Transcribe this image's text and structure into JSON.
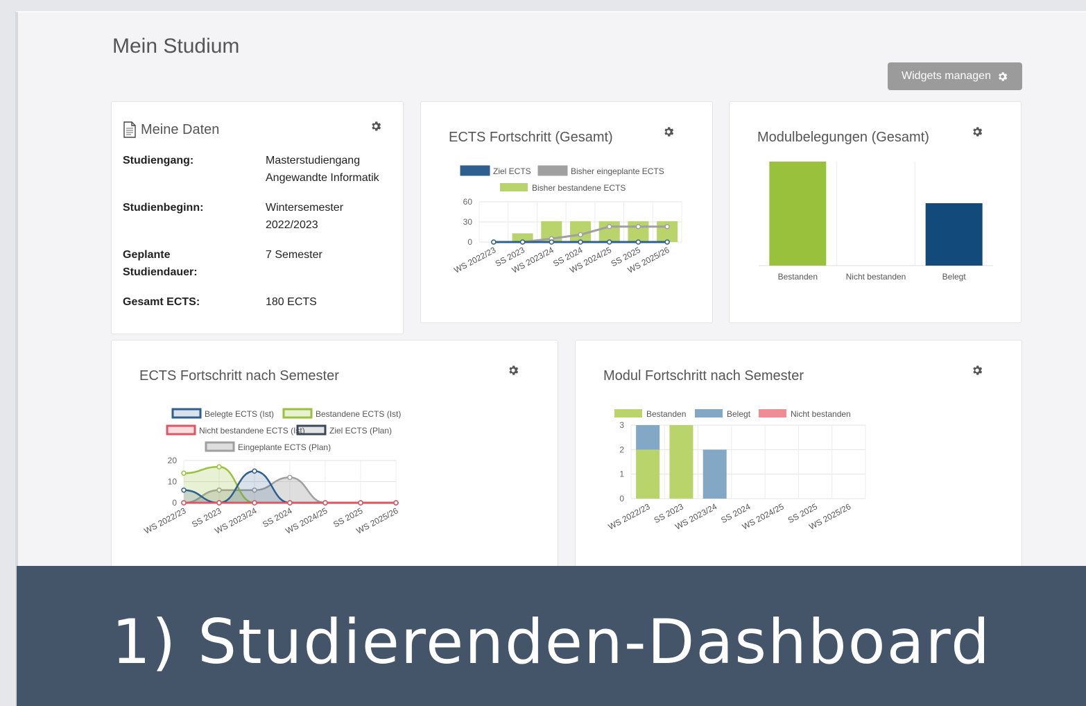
{
  "page": {
    "title": "Mein Studium",
    "widgets_button": "Widgets managen"
  },
  "meine_daten": {
    "title": "Meine Daten",
    "rows": [
      {
        "label": "Studiengang:",
        "value_lines": [
          "Masterstudiengang",
          "Angewandte Informatik"
        ]
      },
      {
        "label": "Studienbeginn:",
        "value_lines": [
          "Wintersemester",
          "2022/2023"
        ]
      },
      {
        "label_lines": [
          "Geplante",
          "Studiendauer:"
        ],
        "value_lines": [
          "7 Semester"
        ]
      },
      {
        "label": "Gesamt ECTS:",
        "value_lines": [
          "180 ECTS"
        ]
      }
    ]
  },
  "chart_data": [
    {
      "id": "ects-gesamt",
      "type": "bar",
      "title": "ECTS Fortschritt (Gesamt)",
      "categories": [
        "WS 2022/23",
        "SS 2023",
        "WS 2023/24",
        "SS 2024",
        "WS 2024/25",
        "SS 2025",
        "WS 2025/26"
      ],
      "series": [
        {
          "name": "Ziel ECTS",
          "kind": "line",
          "color": "#2e5f8f",
          "values": [
            0,
            0,
            0,
            0,
            0,
            0,
            0
          ]
        },
        {
          "name": "Bisher eingeplante ECTS",
          "kind": "line",
          "color": "#a0a0a0",
          "values": [
            0,
            0,
            5,
            11,
            23,
            23,
            23
          ]
        },
        {
          "name": "Bisher bestandene ECTS",
          "kind": "bar",
          "color": "#b8d46a",
          "values": [
            0,
            13,
            31,
            31,
            31,
            31,
            31
          ]
        }
      ],
      "yticks": [
        0,
        30,
        60
      ],
      "ylim": [
        0,
        60
      ]
    },
    {
      "id": "modulbelegungen",
      "type": "bar",
      "title": "Modulbelegungen (Gesamt)",
      "categories": [
        "Bestanden",
        "Nicht bestanden",
        "Belegt"
      ],
      "values": [
        5,
        0,
        3
      ],
      "colors": [
        "#9ac13c",
        "#cccccc",
        "#134a7c"
      ],
      "ylim": [
        0,
        5
      ]
    },
    {
      "id": "ects-semester",
      "type": "area",
      "title": "ECTS Fortschritt nach Semester",
      "categories": [
        "WS 2022/23",
        "SS 2023",
        "WS 2023/24",
        "SS 2024",
        "WS 2024/25",
        "SS 2025",
        "WS 2025/26"
      ],
      "series": [
        {
          "name": "Belegte ECTS (Ist)",
          "color": "#2e5f8f",
          "fill": "rgba(46,95,143,0.18)",
          "values": [
            6,
            0,
            15,
            0,
            0,
            0,
            0
          ]
        },
        {
          "name": "Bestandene ECTS (Ist)",
          "color": "#9ac13c",
          "fill": "rgba(154,193,60,0.22)",
          "values": [
            14,
            17,
            0,
            0,
            0,
            0,
            0
          ]
        },
        {
          "name": "Nicht bestandene ECTS (Ist)",
          "color": "#e05561",
          "fill": "rgba(224,85,97,0.2)",
          "values": [
            0,
            0,
            0,
            0,
            0,
            0,
            0
          ]
        },
        {
          "name": "Ziel ECTS (Plan)",
          "color": "#3c4858",
          "fill": "rgba(60,72,88,0.15)",
          "values": [
            0,
            0,
            0,
            0,
            0,
            0,
            0
          ]
        },
        {
          "name": "Eingeplante ECTS (Plan)",
          "color": "#a0a0a0",
          "fill": "rgba(160,160,160,0.35)",
          "values": [
            0,
            6,
            6,
            12,
            0,
            0,
            0
          ]
        }
      ],
      "yticks": [
        0,
        10,
        20
      ],
      "ylim": [
        0,
        20
      ]
    },
    {
      "id": "modul-semester",
      "type": "bar",
      "title": "Modul Fortschritt nach Semester",
      "categories": [
        "WS 2022/23",
        "SS 2023",
        "WS 2023/24",
        "SS 2024",
        "WS 2024/25",
        "SS 2025",
        "WS 2025/26"
      ],
      "series": [
        {
          "name": "Bestanden",
          "color": "#b8d46a",
          "values": [
            2,
            3,
            0,
            0,
            0,
            0,
            0
          ]
        },
        {
          "name": "Belegt",
          "color": "#83a8c6",
          "values": [
            1,
            0,
            2,
            0,
            0,
            0,
            0
          ]
        },
        {
          "name": "Nicht bestanden",
          "color": "#ee8e94",
          "values": [
            0,
            0,
            0,
            0,
            0,
            0,
            0
          ]
        }
      ],
      "stacked": true,
      "yticks": [
        0,
        1,
        2,
        3
      ],
      "ylim": [
        0,
        3
      ]
    }
  ],
  "footer": {
    "caption": "1) Studierenden-Dashboard"
  },
  "icons": {
    "gear": "gear-icon",
    "document": "document-icon"
  }
}
